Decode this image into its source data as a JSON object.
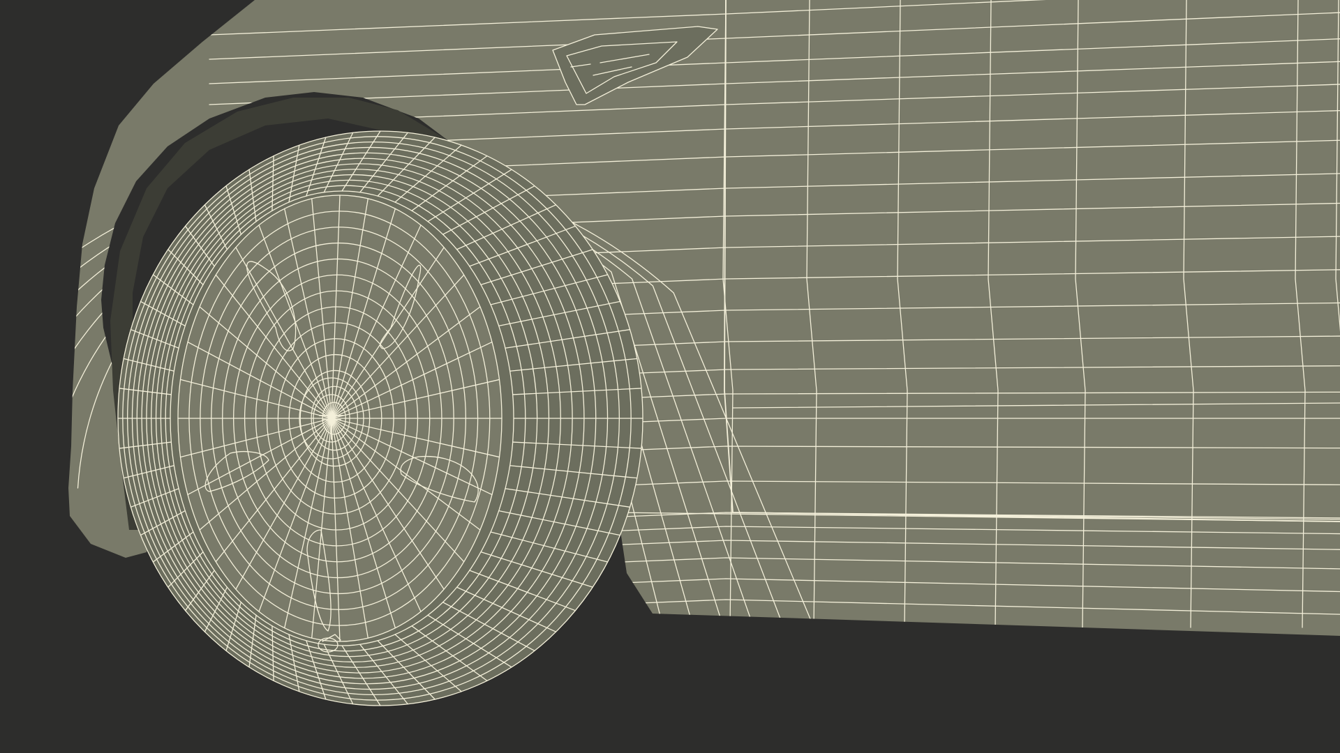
{
  "scene": {
    "subject": "car-front-wheel-wireframe",
    "colors": {
      "background": "#2d2d2c",
      "surface": "#797a69",
      "surface_shade": "#6c6e5e",
      "hole": "#3c3d35",
      "wire": "#f4f0da"
    }
  }
}
